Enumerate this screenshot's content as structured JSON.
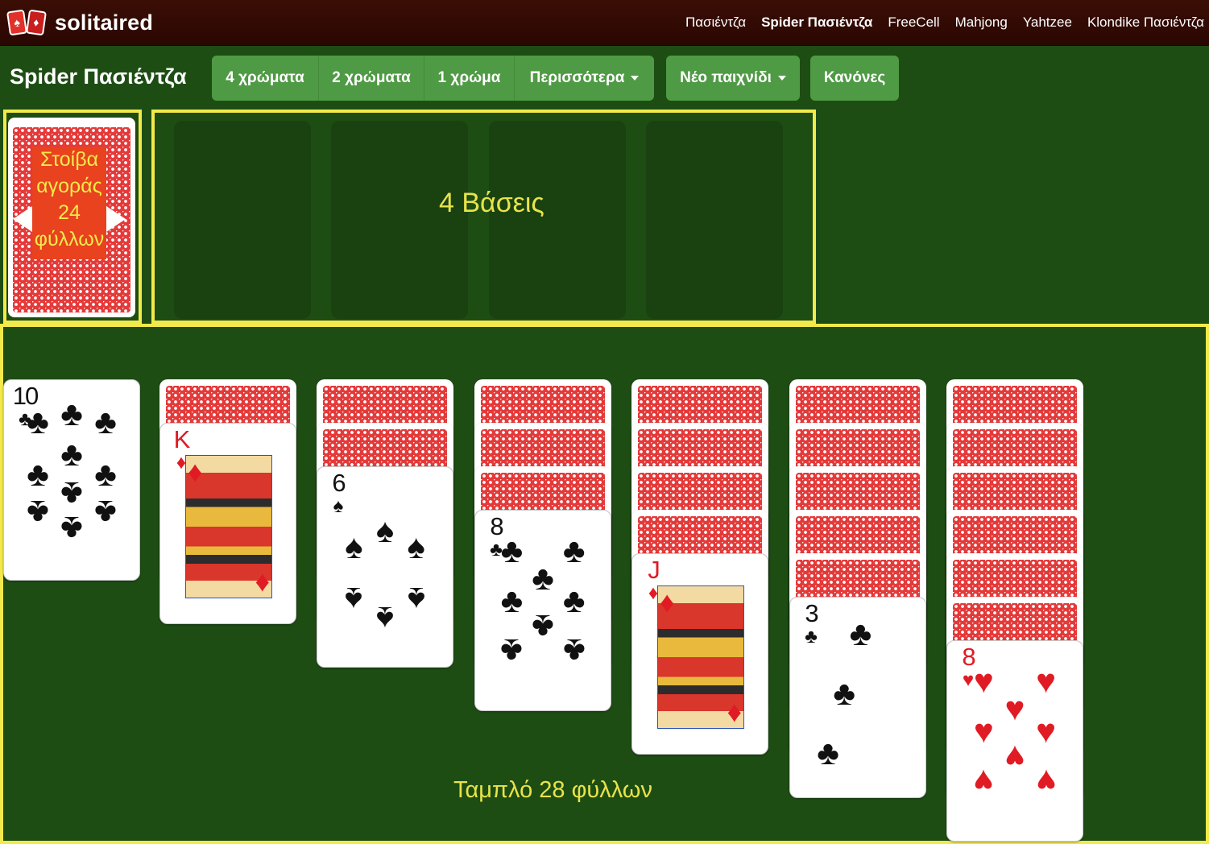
{
  "header": {
    "logo_text": "solitaired",
    "nav": [
      {
        "label": "Πασιέντζα",
        "active": false
      },
      {
        "label": "Spider Πασιέντζα",
        "active": true
      },
      {
        "label": "FreeCell",
        "active": false
      },
      {
        "label": "Mahjong",
        "active": false
      },
      {
        "label": "Yahtzee",
        "active": false
      },
      {
        "label": "Klondike Πασιέντζα",
        "active": false
      }
    ]
  },
  "toolbar": {
    "title": "Spider Πασιέντζα",
    "suits_4": "4 χρώματα",
    "suits_2": "2 χρώματα",
    "suits_1": "1 χρώμα",
    "more": "Περισσότερα",
    "new_game": "Νέο παιχνίδι",
    "rules": "Κανόνες"
  },
  "stock": {
    "line1": "Στοίβα",
    "line2": "αγοράς",
    "line3": "24",
    "line4": "φύλλων"
  },
  "foundations": {
    "label": "4 Βάσεις",
    "slots": 4
  },
  "tableau": {
    "label": "Ταμπλό 28 φύλλων",
    "columns": [
      {
        "hidden": 0,
        "rank": "10",
        "suit": "♣",
        "color": "black"
      },
      {
        "hidden": 1,
        "rank": "K",
        "suit": "♦",
        "color": "red"
      },
      {
        "hidden": 2,
        "rank": "6",
        "suit": "♠",
        "color": "black"
      },
      {
        "hidden": 3,
        "rank": "8",
        "suit": "♣",
        "color": "black"
      },
      {
        "hidden": 4,
        "rank": "J",
        "suit": "♦",
        "color": "red"
      },
      {
        "hidden": 5,
        "rank": "3",
        "suit": "♣",
        "color": "black"
      },
      {
        "hidden": 6,
        "rank": "8",
        "suit": "♥",
        "color": "red"
      }
    ]
  },
  "colors": {
    "felt": "#1e4d14",
    "highlight": "#f2ea4a",
    "button": "#4f9a44",
    "header": "#3b0e05"
  }
}
